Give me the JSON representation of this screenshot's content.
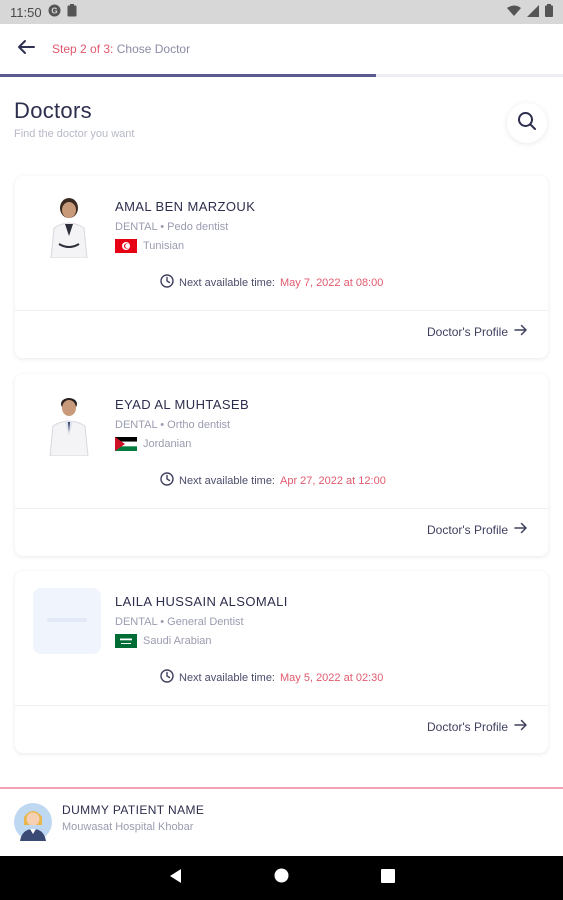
{
  "status_bar": {
    "time": "11:50",
    "icons": [
      "google-icon",
      "clipboard-icon",
      "wifi-icon",
      "signal-icon",
      "battery-icon"
    ]
  },
  "header": {
    "step_prefix": "Step 2 of 3:",
    "step_label": "Chose Doctor",
    "progress": 0.667,
    "title": "Doctors",
    "subtitle": "Find the doctor you want"
  },
  "doctors": [
    {
      "name": "AMAL BEN MARZOUK",
      "specialty": "DENTAL • Pedo dentist",
      "nationality": "Tunisian",
      "flag": "tunisia-flag",
      "next_label": "Next available time:",
      "next_time": "May 7, 2022 at 08:00",
      "profile_label": "Doctor's Profile"
    },
    {
      "name": "EYAD AL MUHTASEB",
      "specialty": "DENTAL • Ortho dentist",
      "nationality": "Jordanian",
      "flag": "jordan-flag",
      "next_label": "Next available time:",
      "next_time": "Apr 27, 2022 at 12:00",
      "profile_label": "Doctor's Profile"
    },
    {
      "name": "LAILA HUSSAIN ALSOMALI",
      "specialty": "DENTAL • General Dentist",
      "nationality": "Saudi Arabian",
      "flag": "saudi-flag",
      "next_label": "Next available time:",
      "next_time": "May 5, 2022 at 02:30",
      "profile_label": "Doctor's Profile"
    }
  ],
  "footer": {
    "patient_name": "DUMMY PATIENT NAME",
    "hospital": "Mouwasat Hospital Khobar"
  },
  "colors": {
    "accent": "#e05a6e",
    "primary": "#2c2e4d",
    "progress": "#5a5c8f",
    "footer_line": "#f3a3b3"
  }
}
